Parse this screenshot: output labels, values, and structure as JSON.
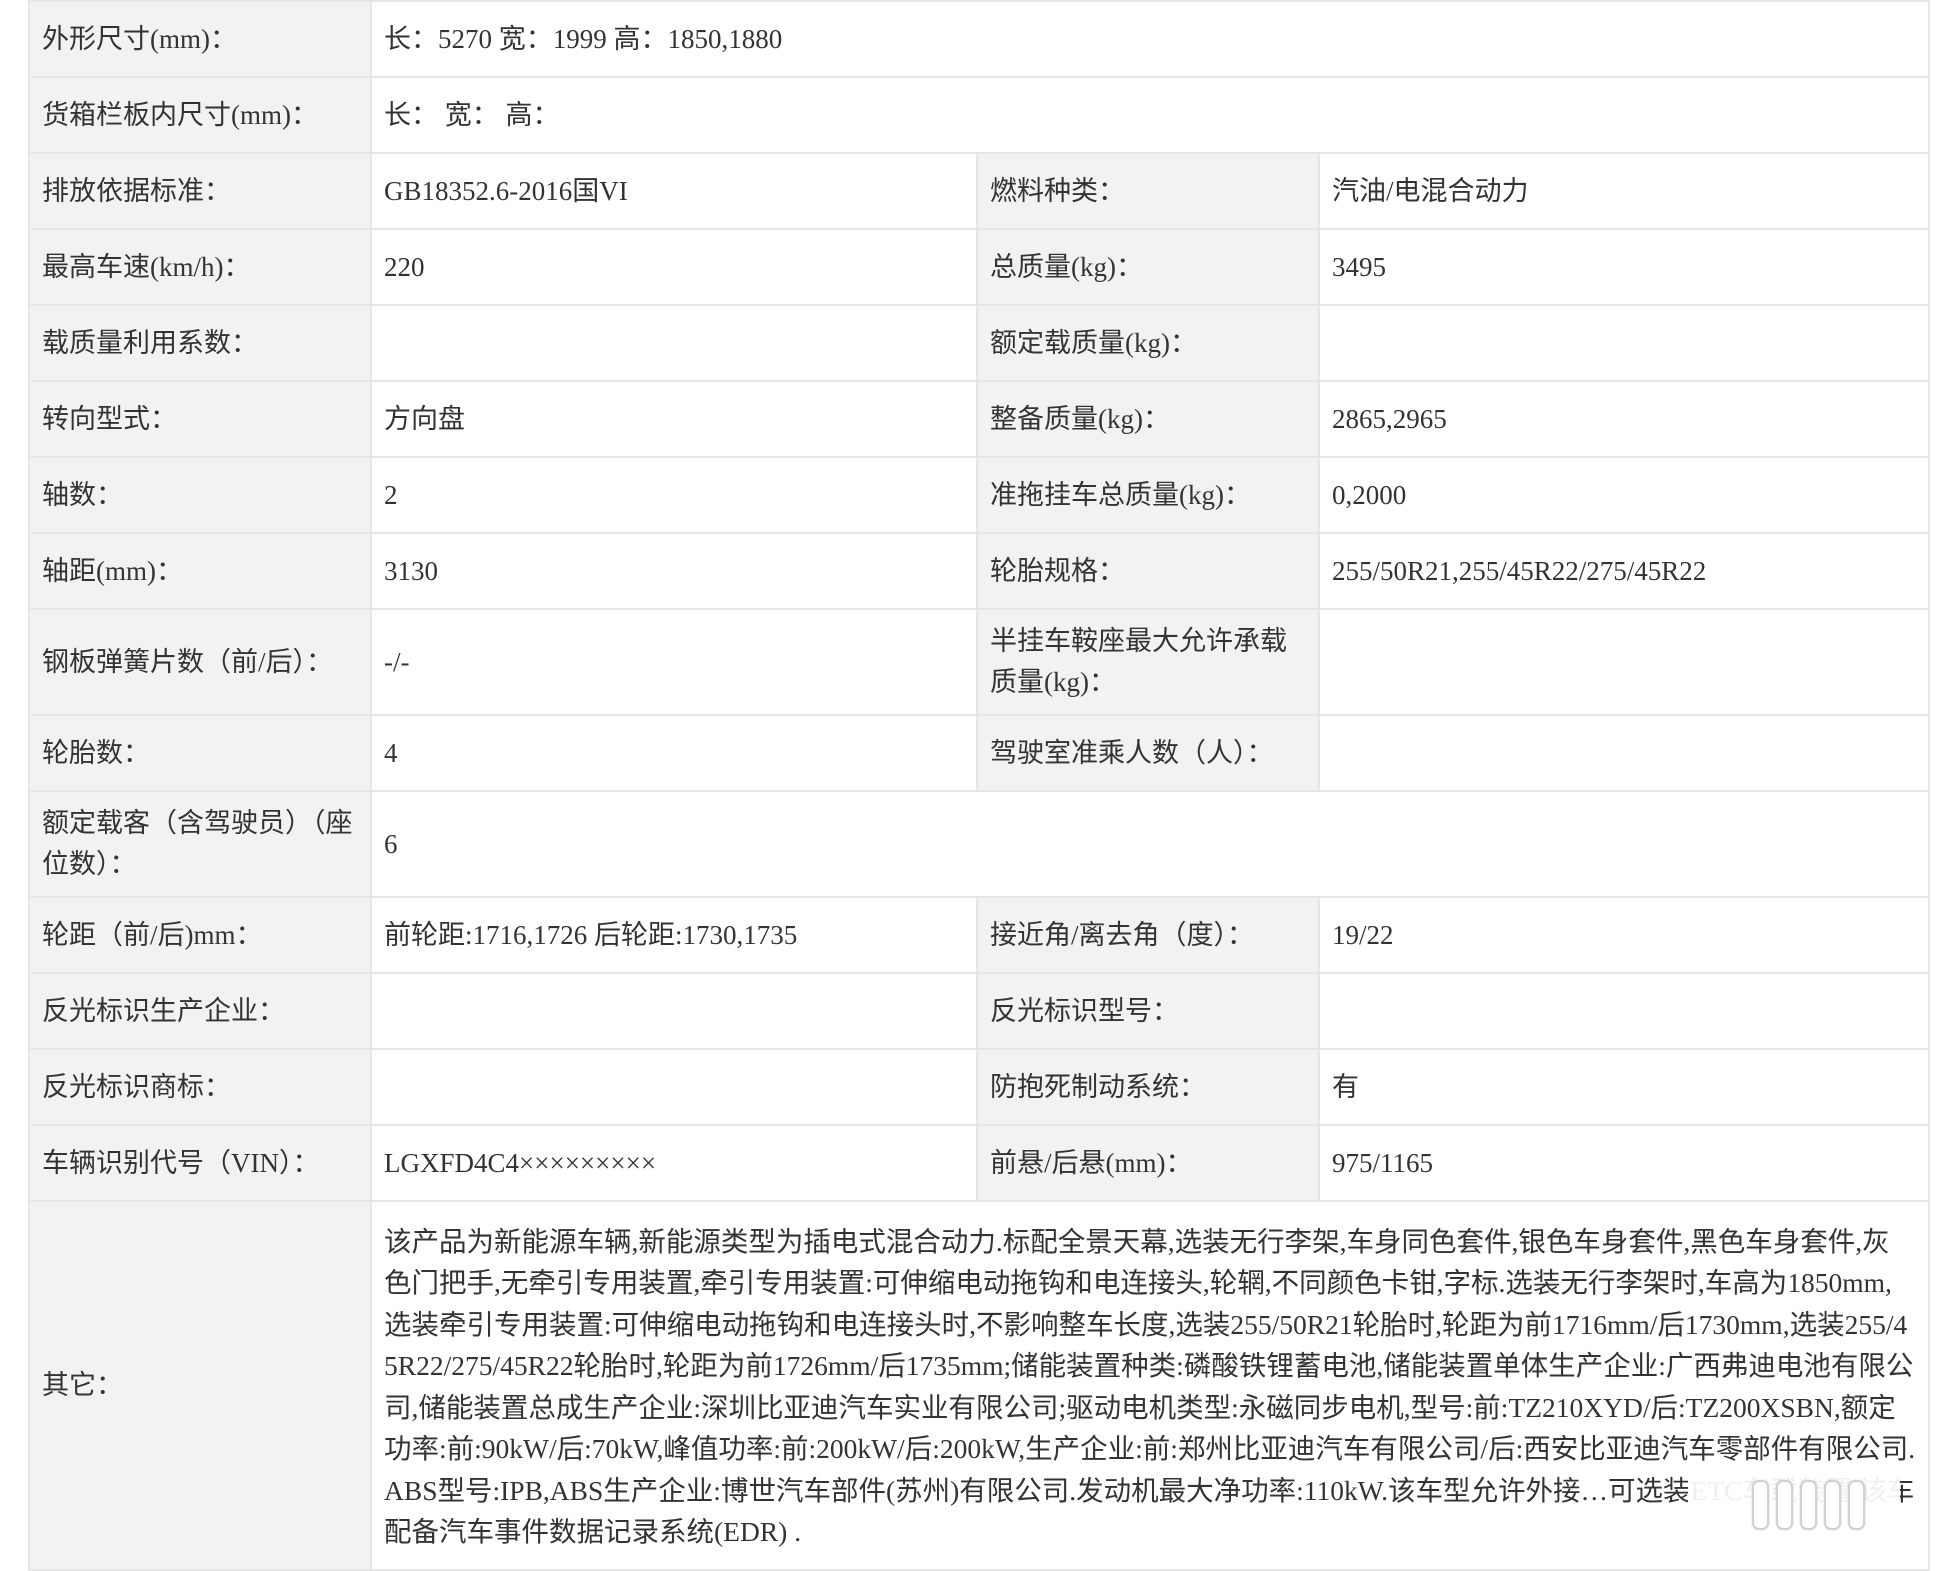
{
  "rows": {
    "outline": {
      "label": "外形尺寸(mm)：",
      "value": "长：5270 宽：1999 高：1850,1880"
    },
    "cargo": {
      "label": "货箱栏板内尺寸(mm)：",
      "value": "长： 宽： 高："
    },
    "emission": {
      "label": "排放依据标准：",
      "value": "GB18352.6-2016国VI",
      "label2": "燃料种类：",
      "value2": "汽油/电混合动力"
    },
    "speed": {
      "label": "最高车速(km/h)：",
      "value": "220",
      "label2": "总质量(kg)：",
      "value2": "3495"
    },
    "load_coef": {
      "label": "载质量利用系数：",
      "value": "",
      "label2": "额定载质量(kg)：",
      "value2": ""
    },
    "steering": {
      "label": "转向型式：",
      "value": "方向盘",
      "label2": "整备质量(kg)：",
      "value2": "2865,2965"
    },
    "axles": {
      "label": "轴数：",
      "value": "2",
      "label2": "准拖挂车总质量(kg)：",
      "value2": "0,2000"
    },
    "wheelbase": {
      "label": "轴距(mm)：",
      "value": "3130",
      "label2": "轮胎规格：",
      "value2": "255/50R21,255/45R22/275/45R22"
    },
    "leaf_spring": {
      "label": "钢板弹簧片数（前/后）：",
      "value": "-/-",
      "label2": "半挂车鞍座最大允许承载质量(kg)：",
      "value2": ""
    },
    "tires": {
      "label": "轮胎数：",
      "value": "4",
      "label2": "驾驶室准乘人数（人）：",
      "value2": ""
    },
    "passengers": {
      "label": "额定载客（含驾驶员）（座位数）：",
      "value": "6"
    },
    "track": {
      "label": "轮距（前/后)mm：",
      "value": "前轮距:1716,1726 后轮距:1730,1735",
      "label2": "接近角/离去角（度）：",
      "value2": "19/22"
    },
    "reflect_maker": {
      "label": "反光标识生产企业：",
      "value": "",
      "label2": "反光标识型号：",
      "value2": ""
    },
    "reflect_brand": {
      "label": "反光标识商标：",
      "value": "",
      "label2": "防抱死制动系统：",
      "value2": "有"
    },
    "vin": {
      "label": "车辆识别代号（VIN）：",
      "value": "LGXFD4C4×××××××××",
      "label2": "前悬/后悬(mm)：",
      "value2": "975/1165"
    },
    "other": {
      "label": "其它：",
      "value": "该产品为新能源车辆,新能源类型为插电式混合动力.标配全景天幕,选装无行李架,车身同色套件,银色车身套件,黑色车身套件,灰色门把手,无牵引专用装置,牵引专用装置:可伸缩电动拖钩和电连接头,轮辋,不同颜色卡钳,字标.选装无行李架时,车高为1850mm,选装牵引专用装置:可伸缩电动拖钩和电连接头时,不影响整车长度,选装255/50R21轮胎时,轮距为前1716mm/后1730mm,选装255/45R22/275/45R22轮胎时,轮距为前1726mm/后1735mm;储能装置种类:磷酸铁锂蓄电池,储能装置单体生产企业:广西弗迪电池有限公司,储能装置总成生产企业:深圳比亚迪汽车实业有限公司;驱动电机类型:永磁同步电机,型号:前:TZ210XYD/后:TZ200XSBN,额定功率:前:90kW/后:70kW,峰值功率:前:200kW/后:200kW,生产企业:前:郑州比亚迪汽车有限公司/后:西安比亚迪汽车零部件有限公司.ABS型号:IPB,ABS生产企业:博世汽车部件(苏州)有限公司.发动机最大净功率:110kW.该车型允许外接…可选装ETC车载装置.该车配备汽车事件数据记录系统(EDR) ."
    }
  },
  "colors": {
    "label_bg": "#f2f2f2",
    "value_bg": "#ffffff",
    "border": "#e6e6e6",
    "text": "#333333"
  }
}
